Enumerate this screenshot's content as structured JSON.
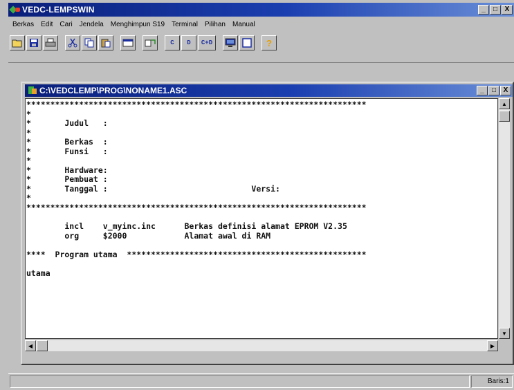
{
  "window": {
    "title": "VEDC-LEMPSWIN",
    "controls": [
      "_",
      "□",
      "X"
    ]
  },
  "menu": {
    "items": [
      "Berkas",
      "Edit",
      "Cari",
      "Jendela",
      "Menghimpun S19",
      "Terminal",
      "Pilihan",
      "Manual"
    ]
  },
  "toolbar": {
    "buttons": [
      {
        "name": "open-icon"
      },
      {
        "name": "save-icon"
      },
      {
        "name": "print-icon"
      },
      {
        "name": "cut-icon"
      },
      {
        "name": "copy-icon"
      },
      {
        "name": "paste-icon"
      },
      {
        "name": "window-icon"
      },
      {
        "name": "tile-icon"
      },
      {
        "name": "c-button",
        "label": "C"
      },
      {
        "name": "d-button",
        "label": "D"
      },
      {
        "name": "c-d-button",
        "label": "C+D"
      },
      {
        "name": "monitor-icon"
      },
      {
        "name": "window-frame-icon"
      },
      {
        "name": "help-icon",
        "label": "?"
      }
    ]
  },
  "document": {
    "title": "C:\\VEDCLEMP\\PROG\\NONAME1.ASC",
    "controls": [
      "_",
      "□",
      "X"
    ],
    "lines": [
      "***********************************************************************",
      "*",
      "*       Judul   :",
      "*",
      "*       Berkas  :",
      "*       Funsi   :",
      "*",
      "*       Hardware:",
      "*       Pembuat :",
      "*       Tanggal :                              Versi:",
      "*",
      "***********************************************************************",
      "",
      "        incl    v_myinc.inc      Berkas definisi alamat EPROM V2.35",
      "        org     $2000            Alamat awal di RAM",
      "",
      "****  Program utama  **************************************************",
      "",
      "utama",
      "",
      "",
      "",
      "",
      "",
      ""
    ]
  },
  "status": {
    "position": "Baris:1"
  }
}
